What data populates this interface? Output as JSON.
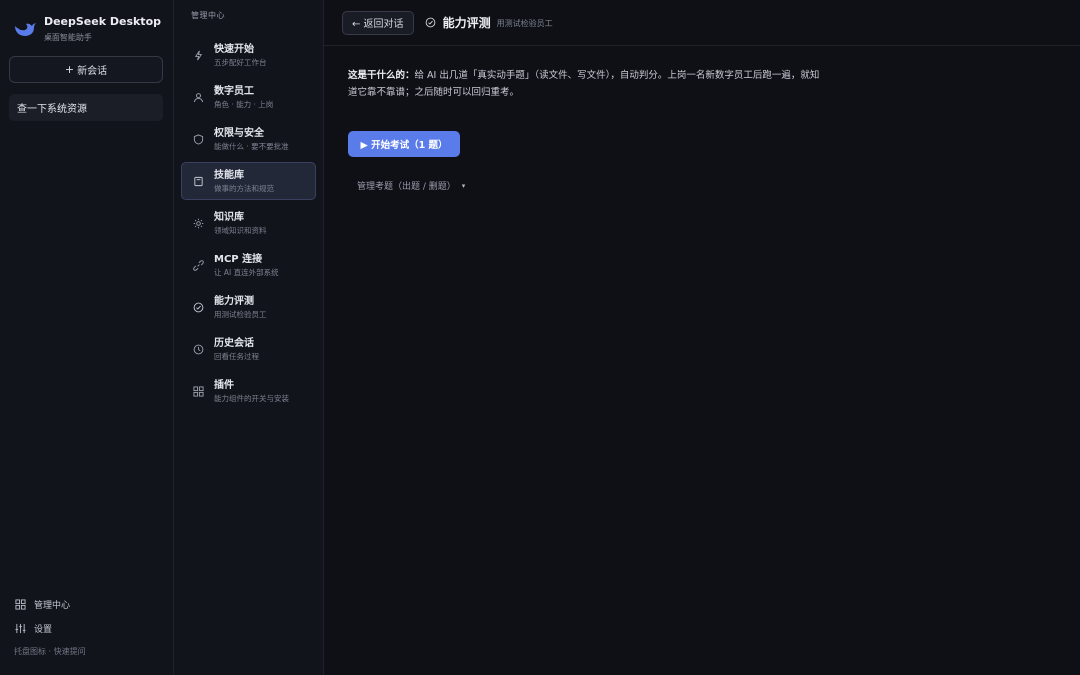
{
  "brand": {
    "title": "DeepSeek Desktop",
    "subtitle": "桌面智能助手",
    "accent": "#5a7bea"
  },
  "sidebar": {
    "new_chat": {
      "icon": "+",
      "label": "新会话"
    },
    "chats": [
      {
        "label": "查一下系统资源"
      }
    ],
    "bottom": {
      "admin_label": "管理中心",
      "settings_label": "设置",
      "tray_hint": "托盘图标 · 快速提问"
    }
  },
  "nav": {
    "header": "管理中心",
    "items": [
      {
        "icon": "lightning-icon",
        "title": "快速开始",
        "sub": "五步配好工作台"
      },
      {
        "icon": "person-icon",
        "title": "数字员工",
        "sub": "角色 · 能力 · 上岗"
      },
      {
        "icon": "shield-icon",
        "title": "权限与安全",
        "sub": "能做什么 · 要不要批准"
      },
      {
        "icon": "book-icon",
        "title": "技能库",
        "sub": "做事的方法和规范",
        "active": true
      },
      {
        "icon": "sun-icon",
        "title": "知识库",
        "sub": "领域知识和资料"
      },
      {
        "icon": "link-icon",
        "title": "MCP 连接",
        "sub": "让 AI 直连外部系统"
      },
      {
        "icon": "check-circle-icon",
        "title": "能力评测",
        "sub": "用测试检验员工"
      },
      {
        "icon": "clock-icon",
        "title": "历史会话",
        "sub": "回看任务过程"
      },
      {
        "icon": "grid-icon",
        "title": "插件",
        "sub": "能力组件的开关与安装"
      }
    ]
  },
  "main": {
    "back_label": "← 返回对话",
    "title": "能力评测",
    "subtitle": "用测试检验员工",
    "desc_label": "这是干什么的：",
    "desc_text": "给 AI 出几道「真实动手题」（读文件、写文件），自动判分。上岗一名新数字员工后跑一遍，就知道它靠不靠谱；之后随时可以回归重考。",
    "start_button": "▶ 开始考试（1 题）",
    "manage_label": "管理考题（出题 / 删题）",
    "manage_caret": "▾"
  }
}
